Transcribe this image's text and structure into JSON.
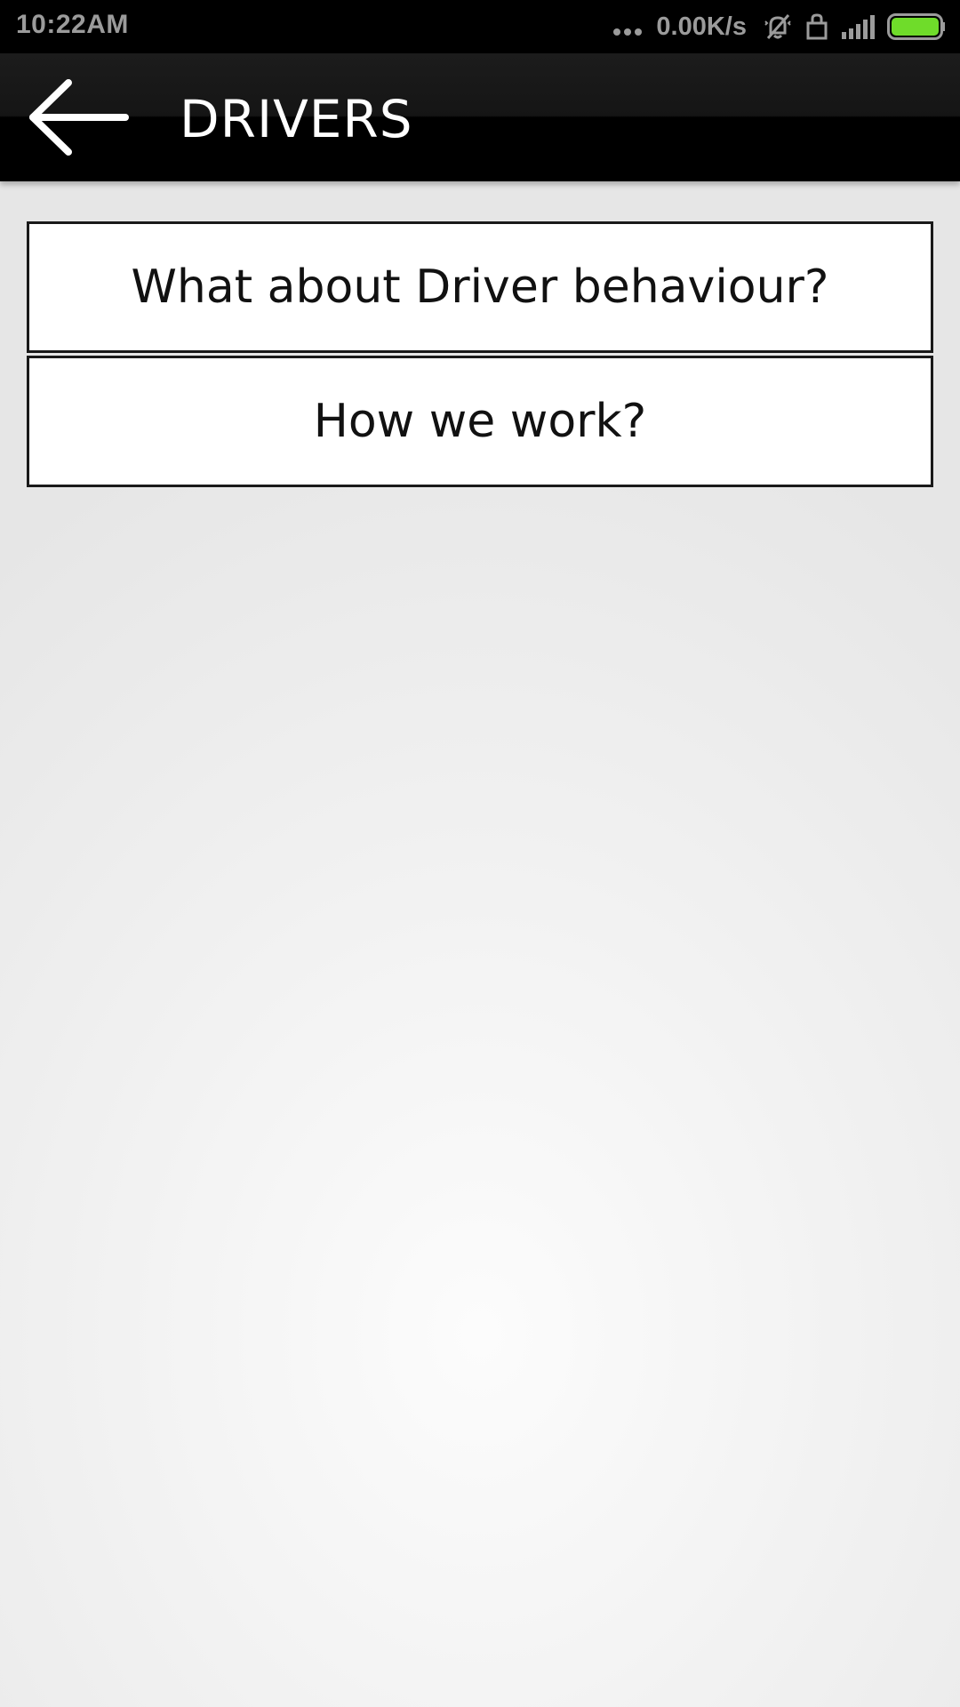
{
  "status_bar": {
    "time": "10:22AM",
    "net_speed": "0.00K/s",
    "battery_color": "#6fdc2a",
    "icons": [
      "more-dots-icon",
      "muted-vibrate-icon",
      "lock-icon",
      "signal-icon",
      "battery-icon"
    ]
  },
  "app_bar": {
    "title": "DRIVERS",
    "back_icon": "back-arrow-icon"
  },
  "menu": {
    "items": [
      {
        "label": "What about Driver behaviour?"
      },
      {
        "label": "How we work?"
      }
    ]
  }
}
